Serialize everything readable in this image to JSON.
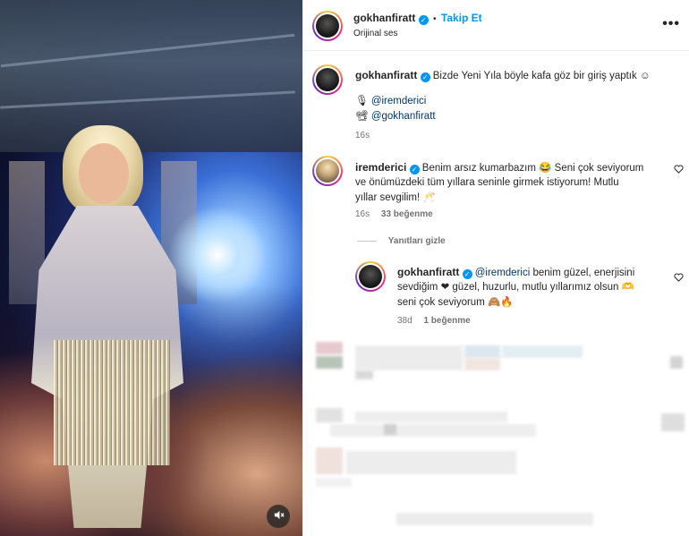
{
  "video": {
    "mute_icon": "speaker-muted-icon"
  },
  "header": {
    "username": "gokhanfiratt",
    "follow_label": "Takip Et",
    "separator": "•",
    "audio": "Orijinal ses",
    "more_icon": "•••"
  },
  "caption": {
    "username": "gokhanfiratt",
    "text": "Bizde Yeni Yıla böyle kafa göz bir giriş yaptık ☺",
    "credit1_icon": "🎙",
    "credit1": "@iremderici",
    "credit2_icon": "📽",
    "credit2": "@gokhanfiratt",
    "time": "16s"
  },
  "comments": [
    {
      "username": "iremderici",
      "text_a": "Benim arsız kumarbazım 😂 Seni çok seviyorum",
      "text_b": "ve önümüzdeki tüm yıllara seninle girmek istiyorum! Mutlu",
      "text_c": "yıllar sevgilim! 🥂",
      "time": "16s",
      "likes": "33 beğenme",
      "hide_replies": "Yanıtları gizle"
    }
  ],
  "reply": {
    "username": "gokhanfiratt",
    "mention": "@iremderici",
    "text_a": "benim güzel, enerjisini",
    "text_b": "sevdiğim ❤ güzel, huzurlu, mutlu yıllarımız olsun 🫶",
    "text_c": "seni çok seviyorum 🙈🔥",
    "time": "38d",
    "likes": "1 beğenme"
  },
  "colors": {
    "accent": "#0095f6",
    "mention": "#00376b",
    "muted": "#737373"
  }
}
